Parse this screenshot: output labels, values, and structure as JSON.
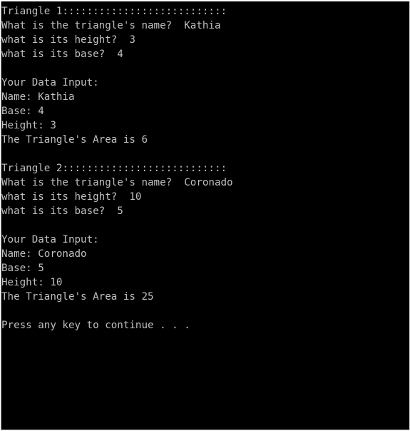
{
  "console": {
    "colors": {
      "background": "#000000",
      "text": "#c0c0c0"
    },
    "lines": [
      "Triangle 1:::::::::::::::::::::::::::",
      "What is the triangle's name?  Kathia",
      "what is its height?  3",
      "what is its base?  4",
      "",
      "Your Data Input:",
      "Name: Kathia",
      "Base: 4",
      "Height: 3",
      "The Triangle's Area is 6",
      "",
      "Triangle 2:::::::::::::::::::::::::::",
      "What is the triangle's name?  Coronado",
      "what is its height?  10",
      "what is its base?  5",
      "",
      "Your Data Input:",
      "Name: Coronado",
      "Base: 5",
      "Height: 10",
      "The Triangle's Area is 25",
      "",
      "Press any key to continue . . ."
    ]
  }
}
